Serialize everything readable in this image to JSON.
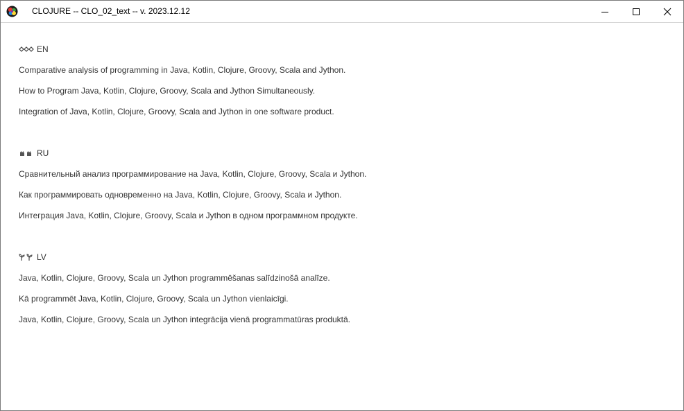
{
  "window": {
    "title": "CLOJURE -- CLO_02_text -- v. 2023.12.12",
    "app_icon": "clojure-logo-icon",
    "controls": {
      "minimize": "minimize-icon",
      "maximize": "maximize-icon",
      "close": "close-icon"
    }
  },
  "sections": [
    {
      "code": "EN",
      "icon": "chain-links-icon",
      "lines": [
        "Comparative analysis of programming in Java, Kotlin, Clojure, Groovy, Scala and Jython.",
        "How to Program Java, Kotlin, Clojure, Groovy, Scala and Jython Simultaneously.",
        "Integration of Java, Kotlin, Clojure, Groovy, Scala and Jython in one software product."
      ]
    },
    {
      "code": "RU",
      "icon": "waving-hands-icon",
      "lines": [
        "Сравнительный анализ программирование на Java, Kotlin, Clojure, Groovy, Scala и Jython.",
        "Как программировать одновременно на Java, Kotlin, Clojure, Groovy, Scala и Jython.",
        "Интеграция Java, Kotlin, Clojure, Groovy, Scala и Jython в одном программном продукте."
      ]
    },
    {
      "code": "LV",
      "icon": "seedlings-icon",
      "lines": [
        "Java, Kotlin, Clojure, Groovy, Scala un Jython programmēšanas salīdzinošā analīze.",
        "Kā programmēt Java, Kotlin, Clojure, Groovy, Scala un Jython vienlaicīgi.",
        "Java, Kotlin, Clojure, Groovy, Scala un Jython integrācija vienā programmatūras produktā."
      ]
    }
  ]
}
